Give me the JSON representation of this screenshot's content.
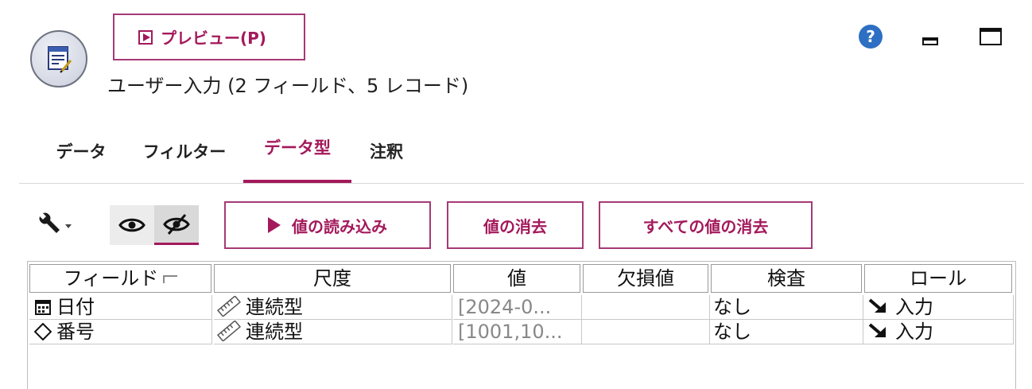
{
  "header": {
    "preview_label": "プレビュー(P)",
    "title": "ユーザー入力 (2 フィールド、5 レコード)",
    "help_icon": "help-icon",
    "help_glyph": "?"
  },
  "tabs": [
    {
      "label": "データ"
    },
    {
      "label": "フィルター"
    },
    {
      "label": "データ型",
      "active": true
    },
    {
      "label": "注釈"
    }
  ],
  "toolbar": {
    "read_values": "値の読み込み",
    "clear_values": "値の消去",
    "clear_all_values": "すべての値の消去"
  },
  "table": {
    "columns": [
      "フィールド",
      "尺度",
      "値",
      "欠損値",
      "検査",
      "ロール"
    ],
    "rows": [
      {
        "field": "日付",
        "field_icon": "calendar-icon",
        "measure": "連続型",
        "value": "[2024-0...",
        "missing": "",
        "check": "なし",
        "role": "入力"
      },
      {
        "field": "番号",
        "field_icon": "diamond-icon",
        "measure": "連続型",
        "value": "[1001,10...",
        "missing": "",
        "check": "なし",
        "role": "入力"
      }
    ]
  },
  "colors": {
    "accent": "#a3195b",
    "help": "#2d6fc2"
  }
}
